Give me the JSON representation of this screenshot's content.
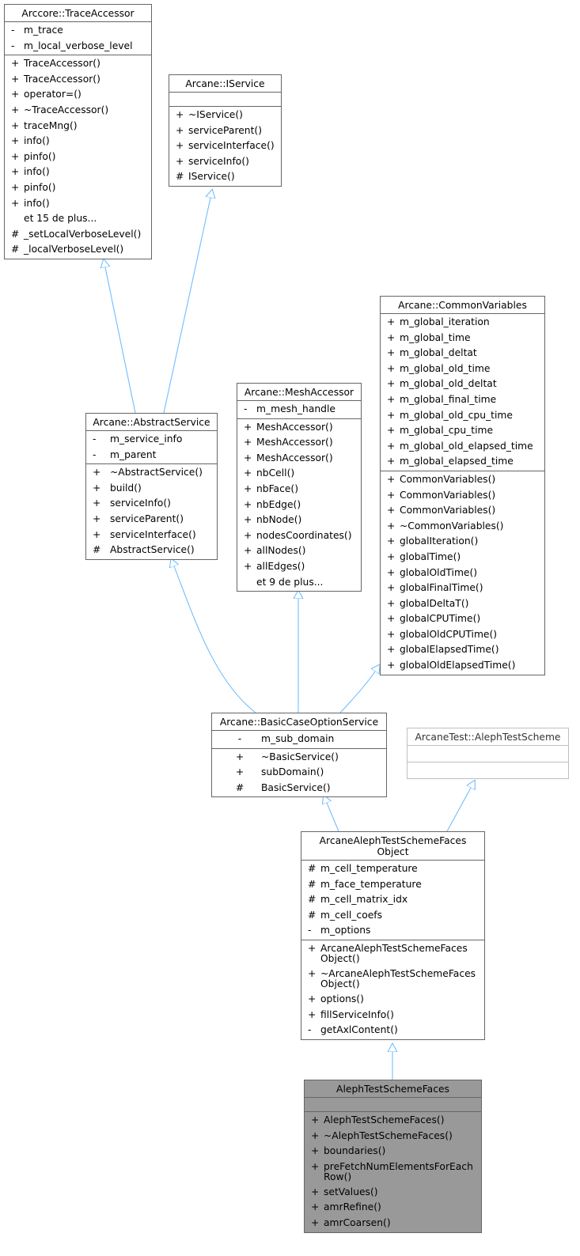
{
  "diagram": {
    "type": "uml-class-inheritance",
    "edge_color": "#63b8ff",
    "current_class_fill": "#999999",
    "classes": {
      "trace_accessor": {
        "name": "Arccore::TraceAccessor",
        "attributes": [
          {
            "vis": "-",
            "name": "m_trace"
          },
          {
            "vis": "-",
            "name": "m_local_verbose_level"
          }
        ],
        "methods": [
          {
            "vis": "+",
            "name": "TraceAccessor()"
          },
          {
            "vis": "+",
            "name": "TraceAccessor()"
          },
          {
            "vis": "+",
            "name": "operator=()"
          },
          {
            "vis": "+",
            "name": "~TraceAccessor()"
          },
          {
            "vis": "+",
            "name": "traceMng()"
          },
          {
            "vis": "+",
            "name": "info()"
          },
          {
            "vis": "+",
            "name": "pinfo()"
          },
          {
            "vis": "+",
            "name": "info()"
          },
          {
            "vis": "+",
            "name": "pinfo()"
          },
          {
            "vis": "+",
            "name": "info()"
          },
          {
            "vis": "",
            "name": "et 15 de plus..."
          },
          {
            "vis": "#",
            "name": "_setLocalVerboseLevel()"
          },
          {
            "vis": "#",
            "name": "_localVerboseLevel()"
          }
        ]
      },
      "iservice": {
        "name": "Arcane::IService",
        "attributes": [],
        "methods": [
          {
            "vis": "+",
            "name": "~IService()"
          },
          {
            "vis": "+",
            "name": "serviceParent()"
          },
          {
            "vis": "+",
            "name": "serviceInterface()"
          },
          {
            "vis": "+",
            "name": "serviceInfo()"
          },
          {
            "vis": "#",
            "name": "IService()"
          }
        ]
      },
      "common_variables": {
        "name": "Arcane::CommonVariables",
        "attributes": [
          {
            "vis": "+",
            "name": "m_global_iteration"
          },
          {
            "vis": "+",
            "name": "m_global_time"
          },
          {
            "vis": "+",
            "name": "m_global_deltat"
          },
          {
            "vis": "+",
            "name": "m_global_old_time"
          },
          {
            "vis": "+",
            "name": "m_global_old_deltat"
          },
          {
            "vis": "+",
            "name": "m_global_final_time"
          },
          {
            "vis": "+",
            "name": "m_global_old_cpu_time"
          },
          {
            "vis": "+",
            "name": "m_global_cpu_time"
          },
          {
            "vis": "+",
            "name": "m_global_old_elapsed_time"
          },
          {
            "vis": "+",
            "name": "m_global_elapsed_time"
          }
        ],
        "methods": [
          {
            "vis": "+",
            "name": "CommonVariables()"
          },
          {
            "vis": "+",
            "name": "CommonVariables()"
          },
          {
            "vis": "+",
            "name": "CommonVariables()"
          },
          {
            "vis": "+",
            "name": "~CommonVariables()"
          },
          {
            "vis": "+",
            "name": "globalIteration()"
          },
          {
            "vis": "+",
            "name": "globalTime()"
          },
          {
            "vis": "+",
            "name": "globalOldTime()"
          },
          {
            "vis": "+",
            "name": "globalFinalTime()"
          },
          {
            "vis": "+",
            "name": "globalDeltaT()"
          },
          {
            "vis": "+",
            "name": "globalCPUTime()"
          },
          {
            "vis": "+",
            "name": "globalOldCPUTime()"
          },
          {
            "vis": "+",
            "name": "globalElapsedTime()"
          },
          {
            "vis": "+",
            "name": "globalOldElapsedTime()"
          }
        ]
      },
      "mesh_accessor": {
        "name": "Arcane::MeshAccessor",
        "attributes": [
          {
            "vis": "-",
            "name": "m_mesh_handle"
          }
        ],
        "methods": [
          {
            "vis": "+",
            "name": "MeshAccessor()"
          },
          {
            "vis": "+",
            "name": "MeshAccessor()"
          },
          {
            "vis": "+",
            "name": "MeshAccessor()"
          },
          {
            "vis": "+",
            "name": "nbCell()"
          },
          {
            "vis": "+",
            "name": "nbFace()"
          },
          {
            "vis": "+",
            "name": "nbEdge()"
          },
          {
            "vis": "+",
            "name": "nbNode()"
          },
          {
            "vis": "+",
            "name": "nodesCoordinates()"
          },
          {
            "vis": "+",
            "name": "allNodes()"
          },
          {
            "vis": "+",
            "name": "allEdges()"
          },
          {
            "vis": "",
            "name": "et 9 de plus..."
          }
        ]
      },
      "abstract_service": {
        "name": "Arcane::AbstractService",
        "attributes": [
          {
            "vis": "-",
            "name": "m_service_info"
          },
          {
            "vis": "-",
            "name": "m_parent"
          }
        ],
        "methods": [
          {
            "vis": "+",
            "name": "~AbstractService()"
          },
          {
            "vis": "+",
            "name": "build()"
          },
          {
            "vis": "+",
            "name": "serviceInfo()"
          },
          {
            "vis": "+",
            "name": "serviceParent()"
          },
          {
            "vis": "+",
            "name": "serviceInterface()"
          },
          {
            "vis": "#",
            "name": "AbstractService()"
          }
        ]
      },
      "basic_case_option_service": {
        "name": "Arcane::BasicCaseOptionService",
        "attributes": [
          {
            "vis": "-",
            "name": "m_sub_domain"
          }
        ],
        "methods": [
          {
            "vis": "+",
            "name": "~BasicService()"
          },
          {
            "vis": "+",
            "name": "subDomain()"
          },
          {
            "vis": "#",
            "name": "BasicService()"
          }
        ]
      },
      "aleph_test_scheme": {
        "name": "ArcaneTest::AlephTestScheme",
        "attributes": [],
        "methods": []
      },
      "faces_object": {
        "name": "ArcaneAlephTestSchemeFaces\nObject",
        "name_line1": "ArcaneAlephTestSchemeFaces",
        "name_line2": "Object",
        "attributes": [
          {
            "vis": "#",
            "name": "m_cell_temperature"
          },
          {
            "vis": "#",
            "name": "m_face_temperature"
          },
          {
            "vis": "#",
            "name": "m_cell_matrix_idx"
          },
          {
            "vis": "#",
            "name": "m_cell_coefs"
          },
          {
            "vis": "-",
            "name": "m_options"
          }
        ],
        "methods": [
          {
            "vis": "+",
            "name": "ArcaneAlephTestSchemeFaces Object()"
          },
          {
            "vis": "+",
            "name": "~ArcaneAlephTestSchemeFaces Object()"
          },
          {
            "vis": "+",
            "name": "options()"
          },
          {
            "vis": "+",
            "name": "fillServiceInfo()"
          },
          {
            "vis": "-",
            "name": "getAxlContent()"
          }
        ]
      },
      "aleph_test_scheme_faces": {
        "name": "AlephTestSchemeFaces",
        "attributes": [],
        "methods": [
          {
            "vis": "+",
            "name": "AlephTestSchemeFaces()"
          },
          {
            "vis": "+",
            "name": "~AlephTestSchemeFaces()"
          },
          {
            "vis": "+",
            "name": "boundaries()"
          },
          {
            "vis": "+",
            "name": "preFetchNumElementsForEach Row()"
          },
          {
            "vis": "+",
            "name": "setValues()"
          },
          {
            "vis": "+",
            "name": "amrRefine()"
          },
          {
            "vis": "+",
            "name": "amrCoarsen()"
          }
        ]
      }
    },
    "inheritance": [
      {
        "child": "abstract_service",
        "parent": "trace_accessor"
      },
      {
        "child": "abstract_service",
        "parent": "iservice"
      },
      {
        "child": "basic_case_option_service",
        "parent": "abstract_service"
      },
      {
        "child": "basic_case_option_service",
        "parent": "mesh_accessor"
      },
      {
        "child": "basic_case_option_service",
        "parent": "common_variables"
      },
      {
        "child": "faces_object",
        "parent": "basic_case_option_service"
      },
      {
        "child": "faces_object",
        "parent": "aleph_test_scheme"
      },
      {
        "child": "aleph_test_scheme_faces",
        "parent": "faces_object"
      }
    ]
  }
}
